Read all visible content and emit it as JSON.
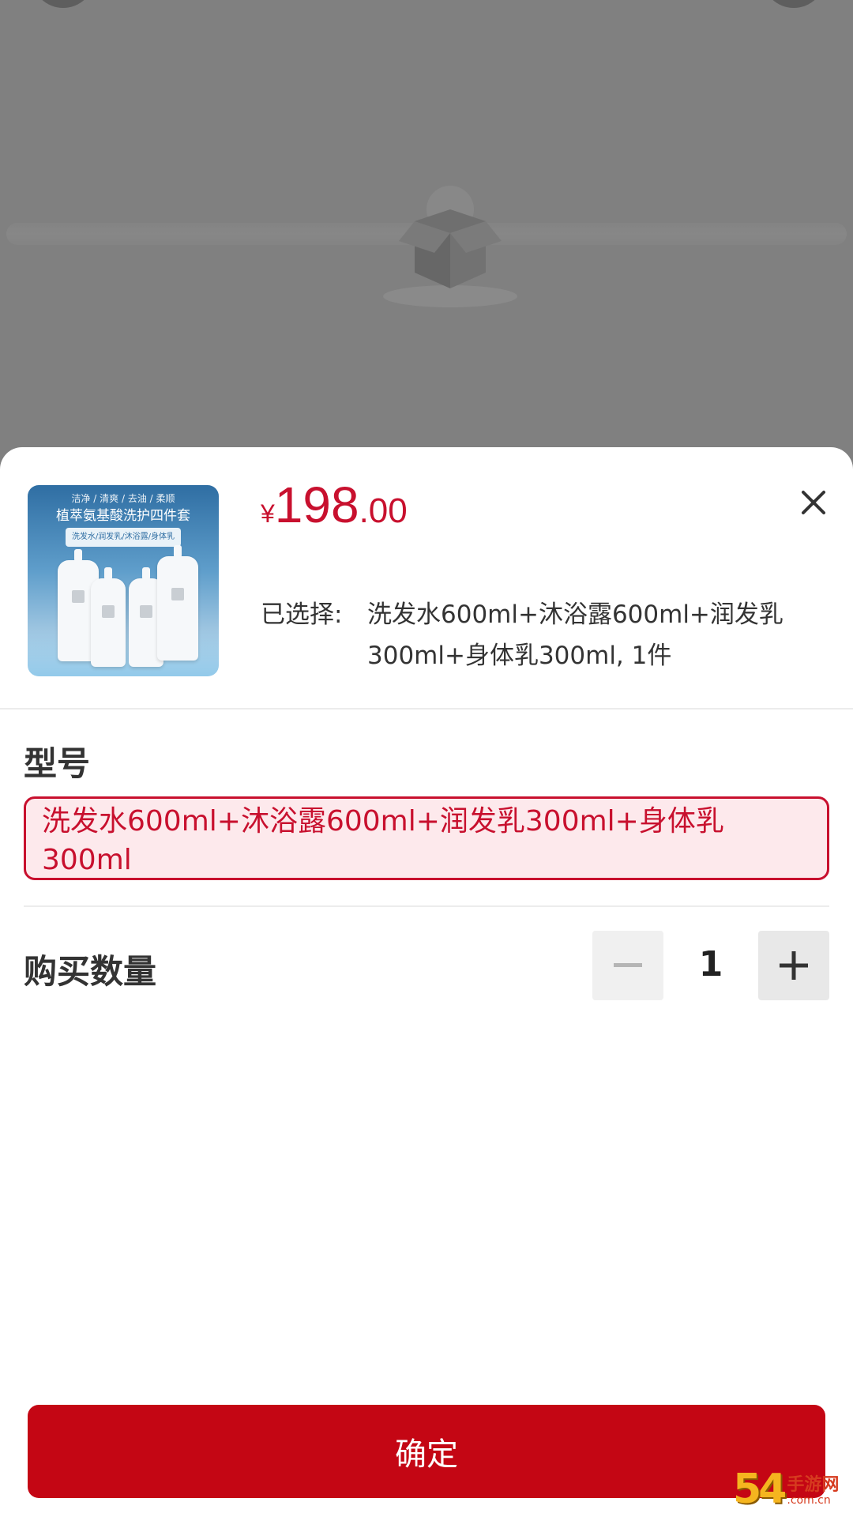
{
  "product": {
    "thumb_top": "洁净 / 清爽 / 去油 / 柔顺",
    "thumb_title": "植萃氨基酸洗护四件套",
    "thumb_sub": "洗发水/润发乳/沐浴露/身体乳"
  },
  "price": {
    "symbol": "¥",
    "integer": "198",
    "decimal": ".00"
  },
  "selected": {
    "label": "已选择:",
    "value": "洗发水600ml+沐浴露600ml+润发乳300ml+身体乳300ml, 1件"
  },
  "variant": {
    "title": "型号",
    "option": "洗发水600ml+沐浴露600ml+润发乳300ml+身体乳300ml"
  },
  "quantity": {
    "label": "购买数量",
    "value": "1"
  },
  "confirm_label": "确定",
  "watermark": {
    "digits": "54",
    "main": "手游网",
    "domain": ".com.cn"
  },
  "colors": {
    "accent": "#c8102e",
    "button": "#c40614",
    "option_bg": "#fde9ec"
  }
}
